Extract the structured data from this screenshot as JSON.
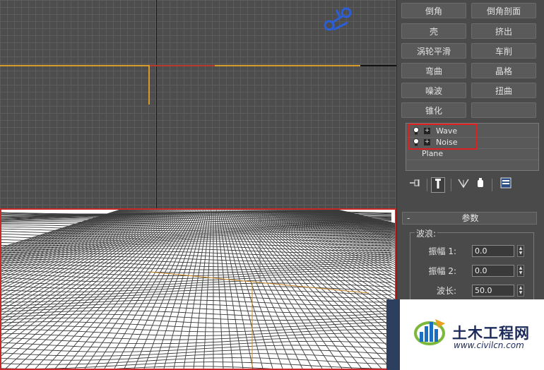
{
  "modifier_buttons": [
    {
      "id": "chamfer",
      "label": "倒角"
    },
    {
      "id": "bevel-profile",
      "label": "倒角剖面"
    },
    {
      "id": "shell",
      "label": "壳"
    },
    {
      "id": "extrude",
      "label": "挤出"
    },
    {
      "id": "turbosmooth",
      "label": "涡轮平滑"
    },
    {
      "id": "lathe",
      "label": "车削"
    },
    {
      "id": "bend",
      "label": "弯曲"
    },
    {
      "id": "lattice",
      "label": "晶格"
    },
    {
      "id": "noise",
      "label": "噪波"
    },
    {
      "id": "twist",
      "label": "扭曲"
    },
    {
      "id": "taper",
      "label": "锥化"
    },
    {
      "id": "empty",
      "label": ""
    }
  ],
  "modifier_stack": [
    {
      "label": "Wave",
      "has_bulb": true,
      "has_expand": true
    },
    {
      "label": "Noise",
      "has_bulb": true,
      "has_expand": true
    },
    {
      "label": "Plane",
      "has_bulb": false,
      "has_expand": false
    }
  ],
  "stack_toolbar": [
    "pin-stack-icon",
    "show-end-result-icon",
    "make-unique-icon",
    "remove-modifier-icon",
    "configure-sets-icon"
  ],
  "params": {
    "rollout_title": "参数",
    "collapse_symbol": "-",
    "group_label": "波浪:",
    "fields": [
      {
        "label": "振幅 1:",
        "value": "0.0"
      },
      {
        "label": "振幅 2:",
        "value": "0.0"
      },
      {
        "label": "波长:",
        "value": "50.0"
      }
    ]
  },
  "watermark": {
    "name": "土木工程网",
    "url": "www.civilcn.com"
  },
  "colors": {
    "highlight": "#e02020",
    "viewport_border": "#c8282a",
    "gizmo": "#d89a2a"
  }
}
